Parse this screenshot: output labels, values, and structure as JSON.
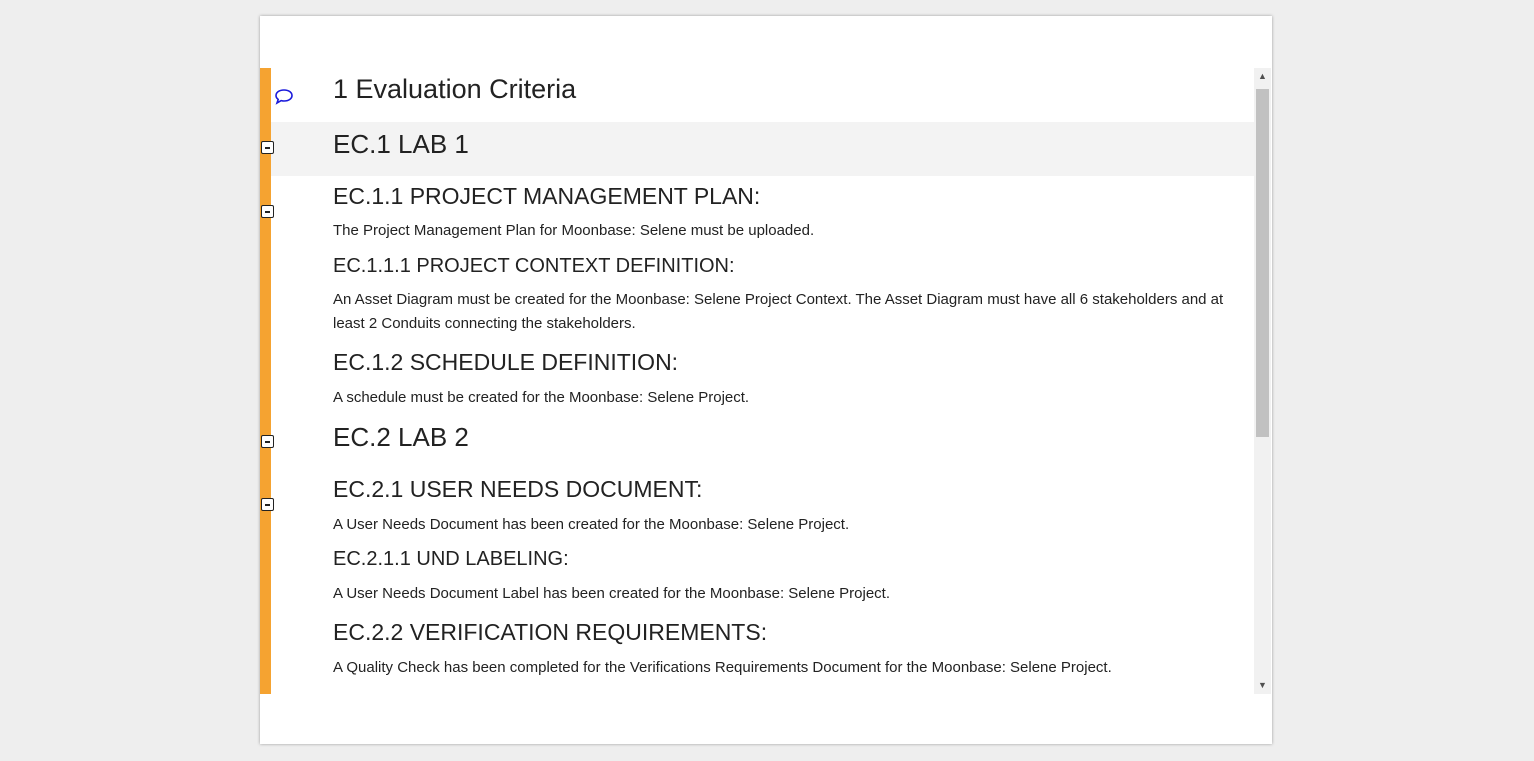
{
  "document": {
    "section_title": "1 Evaluation Criteria",
    "items": [
      {
        "text": "EC.1 LAB 1"
      },
      {
        "text": "EC.1.1 PROJECT MANAGEMENT PLAN:"
      },
      {
        "text": "The Project Management Plan for Moonbase: Selene must be uploaded."
      },
      {
        "text": "EC.1.1.1 PROJECT CONTEXT DEFINITION:"
      },
      {
        "text": "An Asset Diagram must be created for the Moonbase: Selene Project Context. The Asset Diagram must have all 6 stakeholders and at least 2 Conduits connecting the stakeholders."
      },
      {
        "text": "EC.1.2 SCHEDULE DEFINITION:"
      },
      {
        "text": "A schedule must be created for the Moonbase: Selene Project."
      },
      {
        "text": "EC.2 LAB 2"
      },
      {
        "text": "EC.2.1 USER NEEDS DOCUMENT:"
      },
      {
        "text": "A User Needs Document has been created for the Moonbase: Selene Project."
      },
      {
        "text": "EC.2.1.1 UND LABELING:"
      },
      {
        "text": "A User Needs Document Label has been created for the Moonbase: Selene Project."
      },
      {
        "text": "EC.2.2 VERIFICATION REQUIREMENTS:"
      },
      {
        "text": "A Quality Check has been completed for the Verifications Requirements Document for the Moonbase: Selene Project."
      }
    ]
  },
  "icons": {
    "comment": "comment-icon",
    "collapse": "collapse-toggle-icon",
    "scroll_up": "scroll-up-arrow-icon",
    "scroll_down": "scroll-down-arrow-icon"
  },
  "colors": {
    "accent_bar": "#f5a331",
    "comment_icon": "#1a1adb",
    "heading_band": "#f3f3f3"
  }
}
